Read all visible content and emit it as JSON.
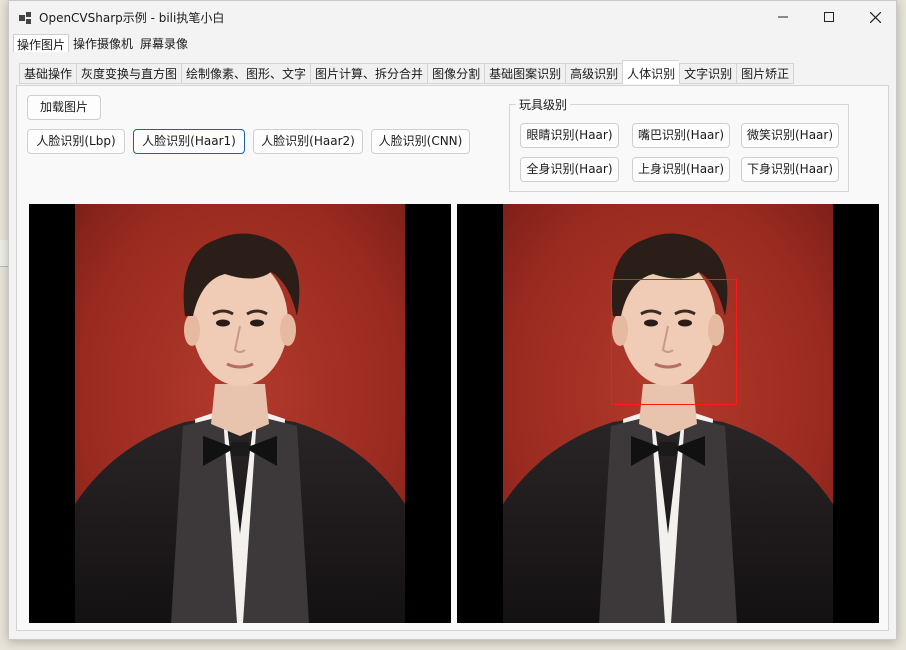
{
  "window": {
    "title": "OpenCVSharp示例 - bili执笔小白"
  },
  "menu": [
    {
      "label": "操作图片",
      "active": true
    },
    {
      "label": "操作摄像机",
      "active": false
    },
    {
      "label": "屏幕录像",
      "active": false
    }
  ],
  "tabs": [
    {
      "label": "基础操作"
    },
    {
      "label": "灰度变换与直方图"
    },
    {
      "label": "绘制像素、图形、文字"
    },
    {
      "label": "图片计算、拆分合并"
    },
    {
      "label": "图像分割"
    },
    {
      "label": "基础图案识别"
    },
    {
      "label": "高级识别"
    },
    {
      "label": "人体识别",
      "active": true
    },
    {
      "label": "文字识别"
    },
    {
      "label": "图片矫正"
    }
  ],
  "panel": {
    "load_button": "加载图片",
    "face_buttons": [
      {
        "label": "人脸识别(Lbp)"
      },
      {
        "label": "人脸识别(Haar1)",
        "focused": true
      },
      {
        "label": "人脸识别(Haar2)"
      },
      {
        "label": "人脸识别(CNN)"
      }
    ],
    "toy_group": {
      "title": "玩具级别",
      "buttons": [
        {
          "label": "眼睛识别(Haar)"
        },
        {
          "label": "嘴巴识别(Haar)"
        },
        {
          "label": "微笑识别(Haar)"
        },
        {
          "label": "全身识别(Haar)"
        },
        {
          "label": "上身识别(Haar)"
        },
        {
          "label": "下身识别(Haar)"
        }
      ]
    }
  },
  "colors": {
    "photo_background": "#9e2b22",
    "detection_rect": "#ff1a1a",
    "focus_border": "#1f5fa8"
  }
}
